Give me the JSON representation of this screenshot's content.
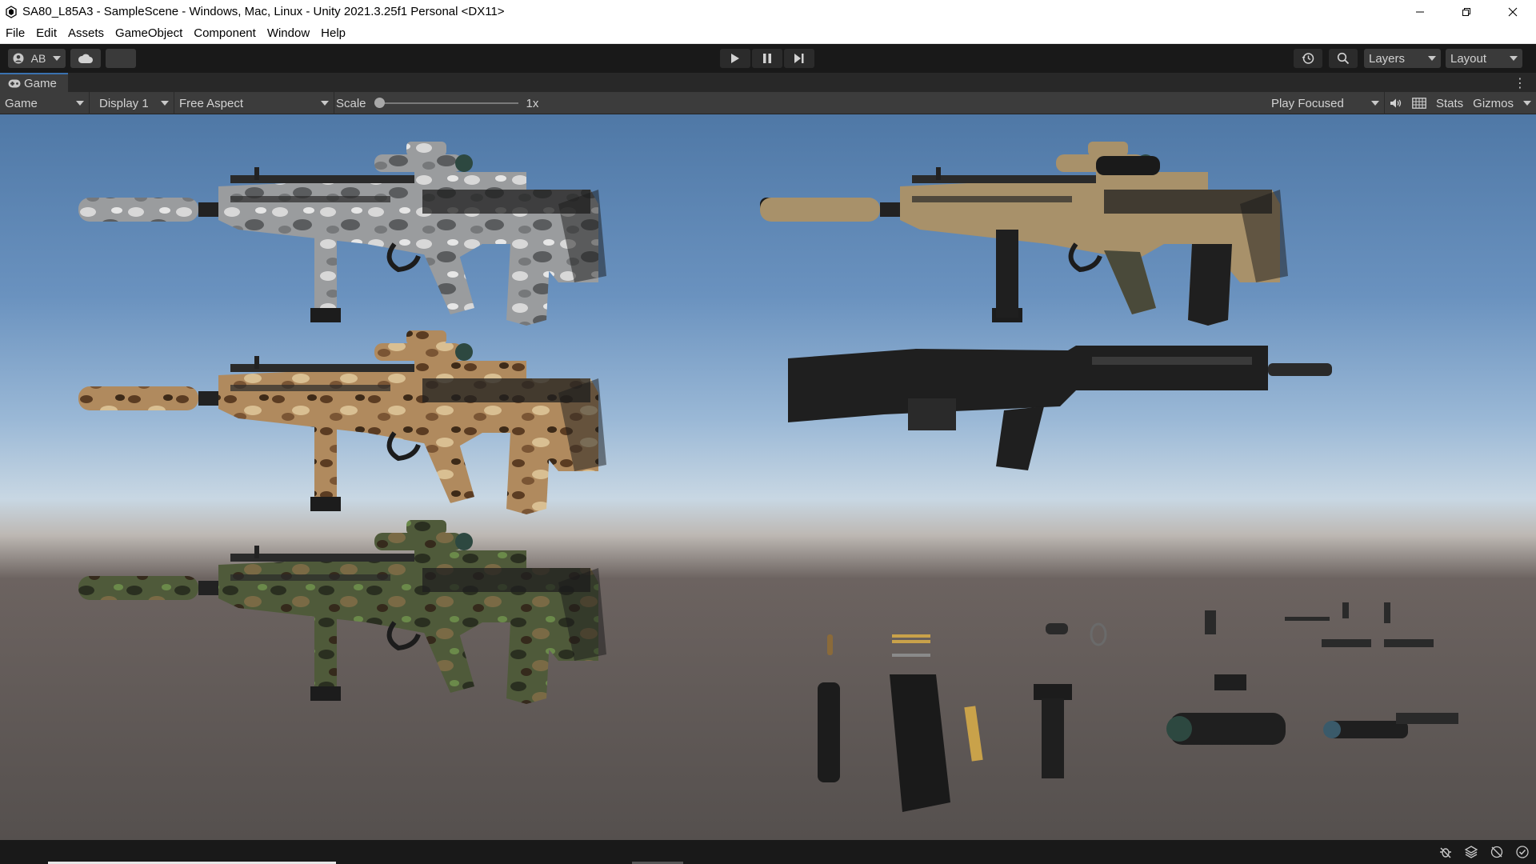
{
  "window": {
    "title": "SA80_L85A3 - SampleScene - Windows, Mac, Linux - Unity 2021.3.25f1 Personal <DX11>"
  },
  "menu": [
    "File",
    "Edit",
    "Assets",
    "GameObject",
    "Component",
    "Window",
    "Help"
  ],
  "toolbar": {
    "account_label": "AB",
    "layers_label": "Layers",
    "layout_label": "Layout"
  },
  "tab": {
    "label": "Game"
  },
  "gamebar": {
    "view_dropdown": "Game",
    "display_dropdown": "Display 1",
    "aspect_dropdown": "Free Aspect",
    "scale_label": "Scale",
    "scale_value": "1x",
    "scale_fraction": 0,
    "play_mode_dropdown": "Play Focused",
    "stats_label": "Stats",
    "gizmos_label": "Gizmos"
  },
  "colors": {
    "toolbar_bg": "#191919",
    "panel_bg": "#3c3c3c",
    "sky_top": "#4f78a6",
    "horizon": "#c8d7e3",
    "ground": "#55504e",
    "camo_urban": "#b8b8b8",
    "camo_desert": "#9c7a52",
    "camo_woodland": "#4c5536",
    "tan": "#a8916a",
    "black": "#1f1f1f"
  },
  "scene_objects": [
    "rifle-urban-camo",
    "rifle-tan",
    "rifle-desert-camo",
    "rifle-black-no-stock",
    "rifle-woodland-camo",
    "parts-cartridge",
    "parts-ammo-belt",
    "parts-suppressor",
    "parts-magazine",
    "parts-bullet-strip",
    "parts-foregrip",
    "parts-scope",
    "parts-flashlight"
  ]
}
